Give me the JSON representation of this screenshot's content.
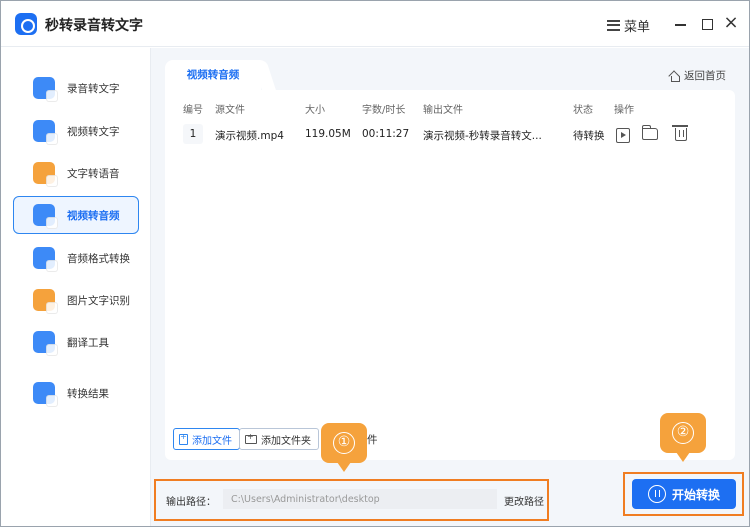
{
  "app": {
    "title": "秒转录音转文字",
    "menu_label": "菜单"
  },
  "sidebar": {
    "items": [
      {
        "label": "录音转文字",
        "icon": "mic-text-icon"
      },
      {
        "label": "视频转文字",
        "icon": "video-text-icon"
      },
      {
        "label": "文字转语音",
        "icon": "text-speech-icon"
      },
      {
        "label": "视频转音频",
        "icon": "video-audio-icon"
      },
      {
        "label": "音频格式转换",
        "icon": "audio-format-icon"
      },
      {
        "label": "图片文字识别",
        "icon": "image-ocr-icon"
      },
      {
        "label": "翻译工具",
        "icon": "translate-icon"
      },
      {
        "label": "转换结果",
        "icon": "results-icon"
      }
    ],
    "active_index": 3
  },
  "main": {
    "tab_label": "视频转音频",
    "home_label": "返回首页",
    "table": {
      "headers": [
        "编号",
        "源文件",
        "大小",
        "字数/时长",
        "输出文件",
        "状态",
        "操作"
      ],
      "rows": [
        {
          "num": "1",
          "source": "演示视频.mp4",
          "size": "119.05M",
          "duration": "00:11:27",
          "output": "演示视频-秒转录音转文...",
          "status": "待转换"
        }
      ]
    },
    "add_file_label": "添加文件",
    "add_folder_label": "添加文件夹",
    "partial_text": "件"
  },
  "output": {
    "label": "输出路径：",
    "path": "C:\\Users\\Administrator\\desktop",
    "change_label": "更改路径"
  },
  "start_label": "开始转换",
  "markers": [
    "①",
    "②"
  ],
  "colors": {
    "accent": "#1d6ff2",
    "highlight": "#f07d22",
    "marker": "#f5a23c"
  }
}
